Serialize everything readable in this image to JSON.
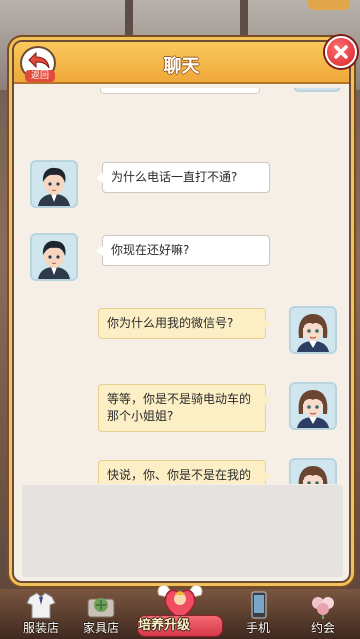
{
  "header": {
    "title": "聊天",
    "back_label": "返回"
  },
  "messages": [
    {
      "side": "left",
      "text": "为什么电话一直打不通?"
    },
    {
      "side": "left",
      "text": "你现在还好嘛?"
    },
    {
      "side": "right",
      "text": "你为什么用我的微信号?"
    },
    {
      "side": "right",
      "text": "等等，你是不是骑电动车的那个小姐姐?"
    },
    {
      "side": "right",
      "text": "快说，你、你是不是在我的身体里面"
    }
  ],
  "bottom_nav": {
    "items": [
      {
        "label": "服装店",
        "icon": "shirt-icon"
      },
      {
        "label": "家具店",
        "icon": "furniture-icon"
      },
      {
        "label": "培养升级",
        "icon": "cupid-heart-icon"
      },
      {
        "label": "手机",
        "icon": "phone-icon"
      },
      {
        "label": "约会",
        "icon": "date-icon"
      }
    ]
  },
  "colors": {
    "header": "#f0a83a",
    "panel": "#f5efe7",
    "bubble_left": "#ffffff",
    "bubble_right": "#fcefc5",
    "close": "#d8232b"
  }
}
